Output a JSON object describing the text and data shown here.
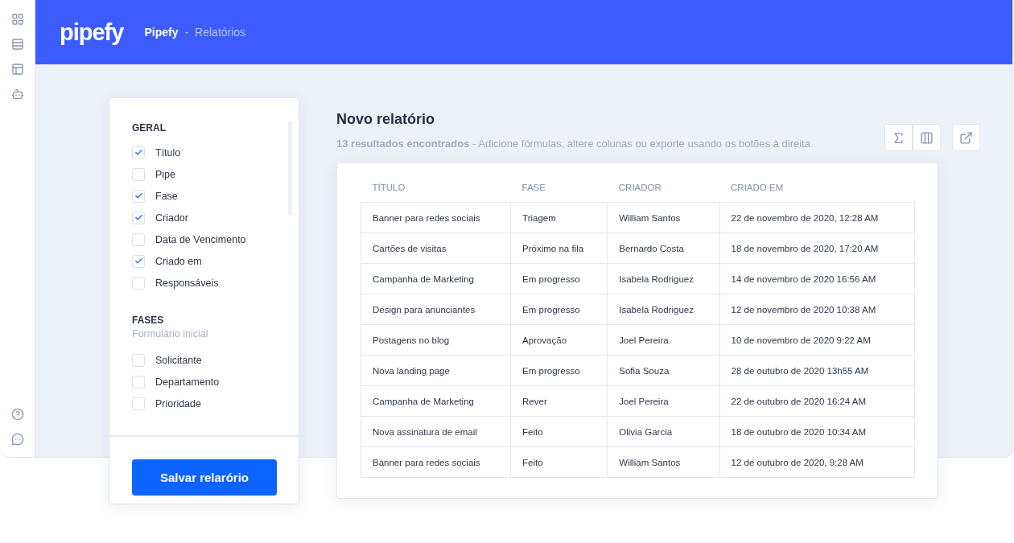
{
  "header": {
    "logo": "pipefy",
    "breadcrumb": [
      {
        "label": "Pipefy",
        "selected": true
      },
      {
        "label": "-",
        "selected": false
      },
      {
        "label": "Relatórios",
        "selected": false
      }
    ]
  },
  "filters": {
    "sections": [
      {
        "title": "GERAL",
        "items": [
          {
            "label": "Título",
            "checked": true
          },
          {
            "label": "Pipe",
            "checked": false
          },
          {
            "label": "Fase",
            "checked": true
          },
          {
            "label": "Criador",
            "checked": true
          },
          {
            "label": "Data de Vencimento",
            "checked": false
          },
          {
            "label": "Criado em",
            "checked": true
          },
          {
            "label": "Responsáveis",
            "checked": false
          }
        ]
      },
      {
        "title": "FASES",
        "subtitle": "Formulário inicial",
        "items": [
          {
            "label": "Solicitante",
            "checked": false
          },
          {
            "label": "Departamento",
            "checked": false
          },
          {
            "label": "Prioridade",
            "checked": false
          }
        ]
      }
    ],
    "save_button": "Salvar relarório"
  },
  "report": {
    "title": "Novo relatório",
    "count": "13 resultados encontrados",
    "hint": "- Adicione fórmulas, altere colunas ou exporte usando os botões à direita",
    "table": {
      "columns": [
        "TÍTULO",
        "FASE",
        "CRIADOR",
        "CRIADO EM"
      ],
      "rows": [
        [
          "Banner para redes sociais",
          "Triagem",
          "William Santos",
          "22 de novembro de 2020, 12:28 AM"
        ],
        [
          "Cartões de visitas",
          "Próximo na fila",
          "Bernardo Costa",
          "18 de novembro de 2020, 17:20 AM"
        ],
        [
          "Campanha de Marketing",
          "Em progresso",
          "Isabela Rodriguez",
          "14 de novembro de 2020 16:56 AM"
        ],
        [
          "Design para anunciantes",
          "Em progresso",
          "Isabela Rodriguez",
          "12 de novembro de 2020 10:38 AM"
        ],
        [
          "Postagens no blog",
          "Aprovação",
          "Joel Pereira",
          "10 de novembro de 2020 9:22 AM"
        ],
        [
          "Nova landing page",
          "Em progresso",
          "Sofia Souza",
          "28 de outubro de 2020 13h55 AM"
        ],
        [
          "Campanha de Marketing",
          "Rever",
          "Joel Pereira",
          "22 de outubro de 2020 16:24 AM"
        ],
        [
          "Nova assinatura de email",
          "Feito",
          "Olivia Garcia",
          "18 de outubro de 2020 10:34 AM"
        ],
        [
          "Banner para redes sociais",
          "Feito",
          "William Santos",
          "12 de outubro de 2020, 9:28 AM"
        ]
      ]
    }
  }
}
